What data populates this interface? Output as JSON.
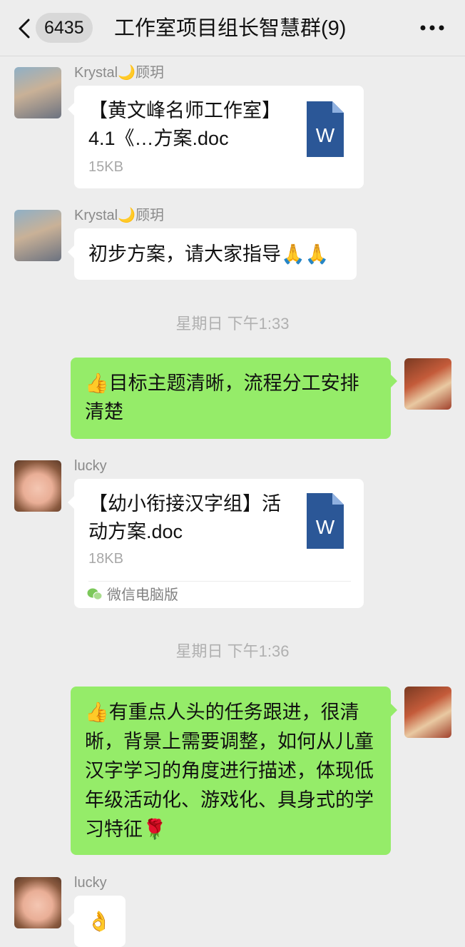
{
  "header": {
    "unread_count": "6435",
    "title": "工作室项目组长智慧群(9)"
  },
  "messages": [
    {
      "sender": "Krystal🌙顾玥",
      "file_name": "【黄文峰名师工作室】4.1《…方案.doc",
      "file_size": "15KB",
      "file_type": "W"
    },
    {
      "sender": "Krystal🌙顾玥",
      "text": "初步方案，请大家指导🙏🙏"
    },
    {
      "timestamp": "星期日 下午1:33"
    },
    {
      "text": "👍目标主题清晰，流程分工安排清楚"
    },
    {
      "sender": "lucky",
      "file_name": "【幼小衔接汉字组】活动方案.doc",
      "file_size": "18KB",
      "file_type": "W",
      "source": "微信电脑版"
    },
    {
      "timestamp": "星期日 下午1:36"
    },
    {
      "text": "👍有重点人头的任务跟进，很清晰，背景上需要调整，如何从儿童汉字学习的角度进行描述，体现低年级活动化、游戏化、具身式的学习特征🌹"
    },
    {
      "sender": "lucky",
      "text": "👌"
    }
  ],
  "icons": {
    "back": "chevron-left-icon",
    "more": "more-dots-icon",
    "word_file": "word-file-icon",
    "wechat_pc": "wechat-icon"
  },
  "colors": {
    "background": "#ededed",
    "self_bubble": "#95ec69",
    "other_bubble": "#ffffff",
    "word_blue": "#2b5797"
  }
}
